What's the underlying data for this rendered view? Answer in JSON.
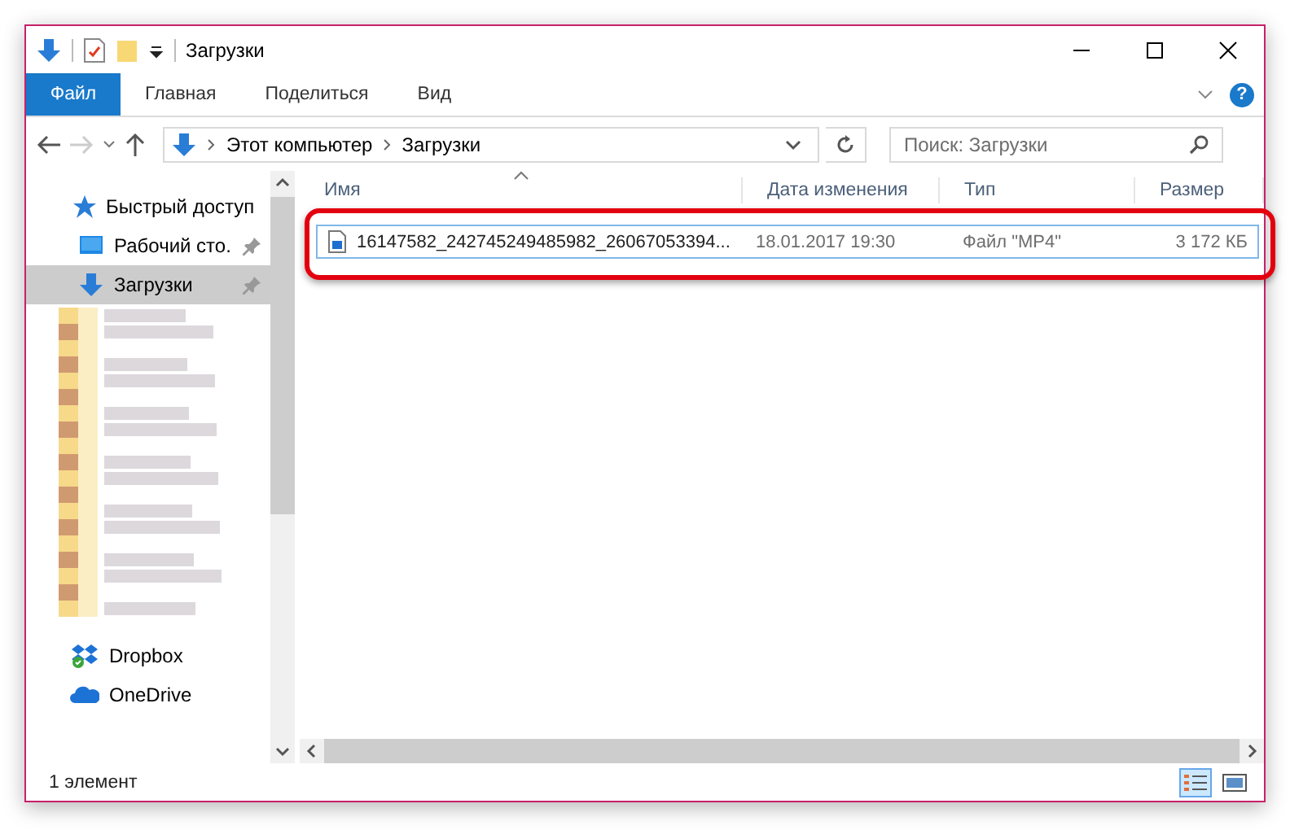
{
  "window": {
    "title": "Загрузки"
  },
  "ribbon": {
    "tabs": [
      {
        "label": "Файл",
        "kind": "file",
        "selected": false
      },
      {
        "label": "Главная",
        "kind": "tab",
        "selected": false
      },
      {
        "label": "Поделиться",
        "kind": "tab",
        "selected": false
      },
      {
        "label": "Вид",
        "kind": "tab",
        "selected": false
      }
    ],
    "help": "?"
  },
  "address": {
    "path": [
      "Этот компьютер",
      "Загрузки"
    ]
  },
  "search": {
    "placeholder": "Поиск: Загрузки"
  },
  "sidebar": {
    "items": [
      {
        "label": "Быстрый доступ",
        "kind": "quick-access",
        "pinned": false,
        "selected": false
      },
      {
        "label": "Рабочий сто.",
        "kind": "desktop",
        "pinned": true,
        "selected": false
      },
      {
        "label": "Загрузки",
        "kind": "downloads",
        "pinned": true,
        "selected": true
      },
      {
        "kind": "blurred"
      },
      {
        "label": "Dropbox",
        "kind": "dropbox",
        "pinned": false,
        "selected": false
      },
      {
        "label": "OneDrive",
        "kind": "onedrive",
        "pinned": false,
        "selected": false
      }
    ]
  },
  "table": {
    "columns": [
      {
        "label": "Имя",
        "sorted": true
      },
      {
        "label": "Дата изменения",
        "sorted": false
      },
      {
        "label": "Тип",
        "sorted": false
      },
      {
        "label": "Размер",
        "sorted": false
      }
    ],
    "rows": [
      {
        "name": "16147582_242745249485982_26067053394...",
        "date": "18.01.2017 19:30",
        "type": "Файл \"MP4\"",
        "size": "3 172 КБ",
        "selected": true
      }
    ]
  },
  "status_bar": {
    "text": "1 элемент",
    "views": [
      {
        "kind": "details",
        "selected": true
      },
      {
        "kind": "tiles",
        "selected": false
      }
    ]
  }
}
